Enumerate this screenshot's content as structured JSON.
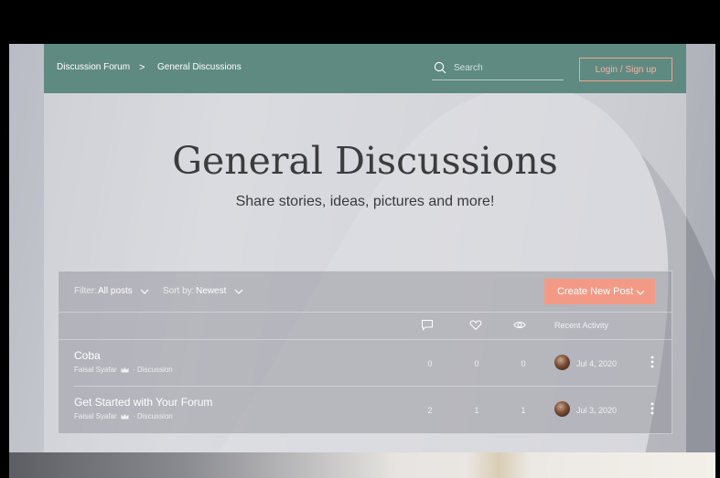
{
  "breadcrumb": {
    "forum": "Discussion Forum",
    "separator": ">",
    "current": "General Discussions"
  },
  "search": {
    "placeholder": "Search",
    "icon": "search-icon"
  },
  "login_button": "Login / Sign up",
  "page": {
    "title": "General Discussions",
    "subtitle": "Share stories, ideas, pictures and more!"
  },
  "toolbar": {
    "filter_label": "Filter:",
    "filter_value": "All posts",
    "sort_label": "Sort by:",
    "sort_value": "Newest",
    "create_label": "Create New Post"
  },
  "columns": {
    "comments_icon": "comment-icon",
    "likes_icon": "heart-icon",
    "views_icon": "eye-icon",
    "recent_activity": "Recent Activity"
  },
  "posts": [
    {
      "title": "Coba",
      "author": "Faisal Syafar",
      "category": "· Discussion",
      "comments": "0",
      "likes": "0",
      "views": "0",
      "date": "Jul 4, 2020"
    },
    {
      "title": "Get Started with Your Forum",
      "author": "Faisal Syafar",
      "category": "· Discussion",
      "comments": "2",
      "likes": "1",
      "views": "1",
      "date": "Jul 3, 2020"
    }
  ],
  "colors": {
    "header": "#5f8a81",
    "accent": "#f39a86",
    "login_border": "#f3a390"
  }
}
